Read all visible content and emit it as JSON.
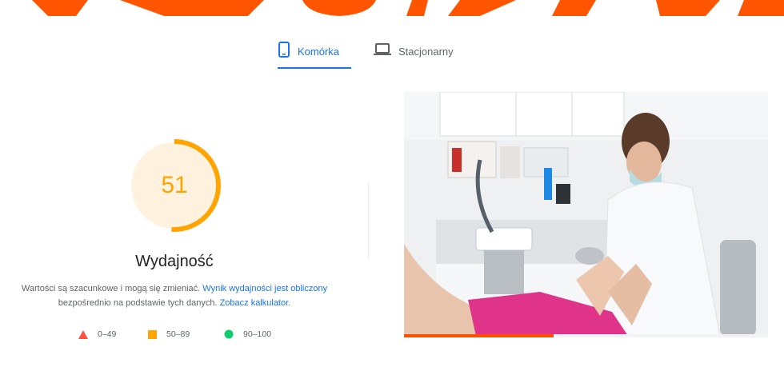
{
  "colors": {
    "accent": "#1a73e8",
    "brand_orange": "#ff5500",
    "score_average": "#ffa400",
    "score_fail": "#ff4e42",
    "score_pass": "#0cce6b"
  },
  "tabs": [
    {
      "label": "Komórka",
      "icon": "mobile-phone-icon",
      "active": true
    },
    {
      "label": "Stacjonarny",
      "icon": "laptop-icon",
      "active": false
    }
  ],
  "performance": {
    "score": "51",
    "score_fraction": 0.51,
    "title": "Wydajność",
    "desc_part1": "Wartości są szacunkowe i mogą się zmieniać. ",
    "desc_link1": "Wynik wydajności jest obliczony",
    "desc_part2": " bezpośrednio na podstawie tych danych. ",
    "desc_link2": "Zobacz kalkulator",
    "desc_part3": "."
  },
  "legend": [
    {
      "shape": "triangle",
      "range": "0–49"
    },
    {
      "shape": "square",
      "range": "50–89"
    },
    {
      "shape": "circle",
      "range": "90–100"
    }
  ],
  "screenshot": {
    "subject": "podiatry-treatment-photo",
    "load_progress": 0.41
  }
}
